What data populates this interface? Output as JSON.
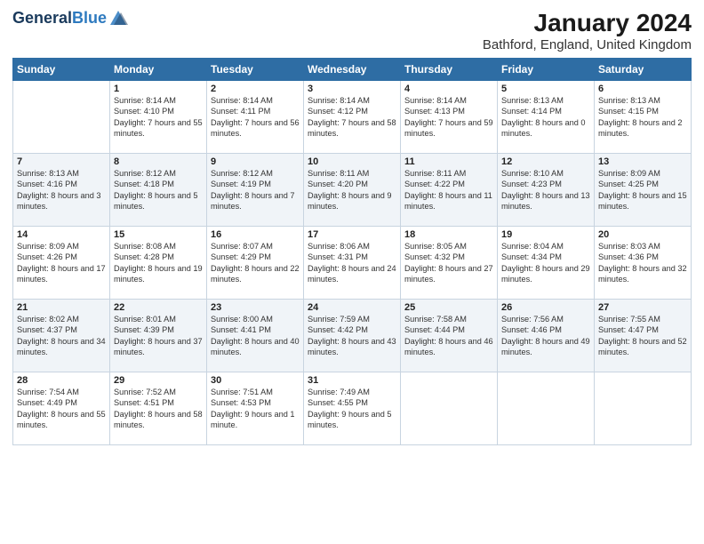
{
  "header": {
    "logo_line1": "General",
    "logo_line2": "Blue",
    "title": "January 2024",
    "subtitle": "Bathford, England, United Kingdom"
  },
  "weekdays": [
    "Sunday",
    "Monday",
    "Tuesday",
    "Wednesday",
    "Thursday",
    "Friday",
    "Saturday"
  ],
  "weeks": [
    [
      {
        "day": "",
        "sunrise": "",
        "sunset": "",
        "daylight": ""
      },
      {
        "day": "1",
        "sunrise": "Sunrise: 8:14 AM",
        "sunset": "Sunset: 4:10 PM",
        "daylight": "Daylight: 7 hours and 55 minutes."
      },
      {
        "day": "2",
        "sunrise": "Sunrise: 8:14 AM",
        "sunset": "Sunset: 4:11 PM",
        "daylight": "Daylight: 7 hours and 56 minutes."
      },
      {
        "day": "3",
        "sunrise": "Sunrise: 8:14 AM",
        "sunset": "Sunset: 4:12 PM",
        "daylight": "Daylight: 7 hours and 58 minutes."
      },
      {
        "day": "4",
        "sunrise": "Sunrise: 8:14 AM",
        "sunset": "Sunset: 4:13 PM",
        "daylight": "Daylight: 7 hours and 59 minutes."
      },
      {
        "day": "5",
        "sunrise": "Sunrise: 8:13 AM",
        "sunset": "Sunset: 4:14 PM",
        "daylight": "Daylight: 8 hours and 0 minutes."
      },
      {
        "day": "6",
        "sunrise": "Sunrise: 8:13 AM",
        "sunset": "Sunset: 4:15 PM",
        "daylight": "Daylight: 8 hours and 2 minutes."
      }
    ],
    [
      {
        "day": "7",
        "sunrise": "Sunrise: 8:13 AM",
        "sunset": "Sunset: 4:16 PM",
        "daylight": "Daylight: 8 hours and 3 minutes."
      },
      {
        "day": "8",
        "sunrise": "Sunrise: 8:12 AM",
        "sunset": "Sunset: 4:18 PM",
        "daylight": "Daylight: 8 hours and 5 minutes."
      },
      {
        "day": "9",
        "sunrise": "Sunrise: 8:12 AM",
        "sunset": "Sunset: 4:19 PM",
        "daylight": "Daylight: 8 hours and 7 minutes."
      },
      {
        "day": "10",
        "sunrise": "Sunrise: 8:11 AM",
        "sunset": "Sunset: 4:20 PM",
        "daylight": "Daylight: 8 hours and 9 minutes."
      },
      {
        "day": "11",
        "sunrise": "Sunrise: 8:11 AM",
        "sunset": "Sunset: 4:22 PM",
        "daylight": "Daylight: 8 hours and 11 minutes."
      },
      {
        "day": "12",
        "sunrise": "Sunrise: 8:10 AM",
        "sunset": "Sunset: 4:23 PM",
        "daylight": "Daylight: 8 hours and 13 minutes."
      },
      {
        "day": "13",
        "sunrise": "Sunrise: 8:09 AM",
        "sunset": "Sunset: 4:25 PM",
        "daylight": "Daylight: 8 hours and 15 minutes."
      }
    ],
    [
      {
        "day": "14",
        "sunrise": "Sunrise: 8:09 AM",
        "sunset": "Sunset: 4:26 PM",
        "daylight": "Daylight: 8 hours and 17 minutes."
      },
      {
        "day": "15",
        "sunrise": "Sunrise: 8:08 AM",
        "sunset": "Sunset: 4:28 PM",
        "daylight": "Daylight: 8 hours and 19 minutes."
      },
      {
        "day": "16",
        "sunrise": "Sunrise: 8:07 AM",
        "sunset": "Sunset: 4:29 PM",
        "daylight": "Daylight: 8 hours and 22 minutes."
      },
      {
        "day": "17",
        "sunrise": "Sunrise: 8:06 AM",
        "sunset": "Sunset: 4:31 PM",
        "daylight": "Daylight: 8 hours and 24 minutes."
      },
      {
        "day": "18",
        "sunrise": "Sunrise: 8:05 AM",
        "sunset": "Sunset: 4:32 PM",
        "daylight": "Daylight: 8 hours and 27 minutes."
      },
      {
        "day": "19",
        "sunrise": "Sunrise: 8:04 AM",
        "sunset": "Sunset: 4:34 PM",
        "daylight": "Daylight: 8 hours and 29 minutes."
      },
      {
        "day": "20",
        "sunrise": "Sunrise: 8:03 AM",
        "sunset": "Sunset: 4:36 PM",
        "daylight": "Daylight: 8 hours and 32 minutes."
      }
    ],
    [
      {
        "day": "21",
        "sunrise": "Sunrise: 8:02 AM",
        "sunset": "Sunset: 4:37 PM",
        "daylight": "Daylight: 8 hours and 34 minutes."
      },
      {
        "day": "22",
        "sunrise": "Sunrise: 8:01 AM",
        "sunset": "Sunset: 4:39 PM",
        "daylight": "Daylight: 8 hours and 37 minutes."
      },
      {
        "day": "23",
        "sunrise": "Sunrise: 8:00 AM",
        "sunset": "Sunset: 4:41 PM",
        "daylight": "Daylight: 8 hours and 40 minutes."
      },
      {
        "day": "24",
        "sunrise": "Sunrise: 7:59 AM",
        "sunset": "Sunset: 4:42 PM",
        "daylight": "Daylight: 8 hours and 43 minutes."
      },
      {
        "day": "25",
        "sunrise": "Sunrise: 7:58 AM",
        "sunset": "Sunset: 4:44 PM",
        "daylight": "Daylight: 8 hours and 46 minutes."
      },
      {
        "day": "26",
        "sunrise": "Sunrise: 7:56 AM",
        "sunset": "Sunset: 4:46 PM",
        "daylight": "Daylight: 8 hours and 49 minutes."
      },
      {
        "day": "27",
        "sunrise": "Sunrise: 7:55 AM",
        "sunset": "Sunset: 4:47 PM",
        "daylight": "Daylight: 8 hours and 52 minutes."
      }
    ],
    [
      {
        "day": "28",
        "sunrise": "Sunrise: 7:54 AM",
        "sunset": "Sunset: 4:49 PM",
        "daylight": "Daylight: 8 hours and 55 minutes."
      },
      {
        "day": "29",
        "sunrise": "Sunrise: 7:52 AM",
        "sunset": "Sunset: 4:51 PM",
        "daylight": "Daylight: 8 hours and 58 minutes."
      },
      {
        "day": "30",
        "sunrise": "Sunrise: 7:51 AM",
        "sunset": "Sunset: 4:53 PM",
        "daylight": "Daylight: 9 hours and 1 minute."
      },
      {
        "day": "31",
        "sunrise": "Sunrise: 7:49 AM",
        "sunset": "Sunset: 4:55 PM",
        "daylight": "Daylight: 9 hours and 5 minutes."
      },
      {
        "day": "",
        "sunrise": "",
        "sunset": "",
        "daylight": ""
      },
      {
        "day": "",
        "sunrise": "",
        "sunset": "",
        "daylight": ""
      },
      {
        "day": "",
        "sunrise": "",
        "sunset": "",
        "daylight": ""
      }
    ]
  ]
}
